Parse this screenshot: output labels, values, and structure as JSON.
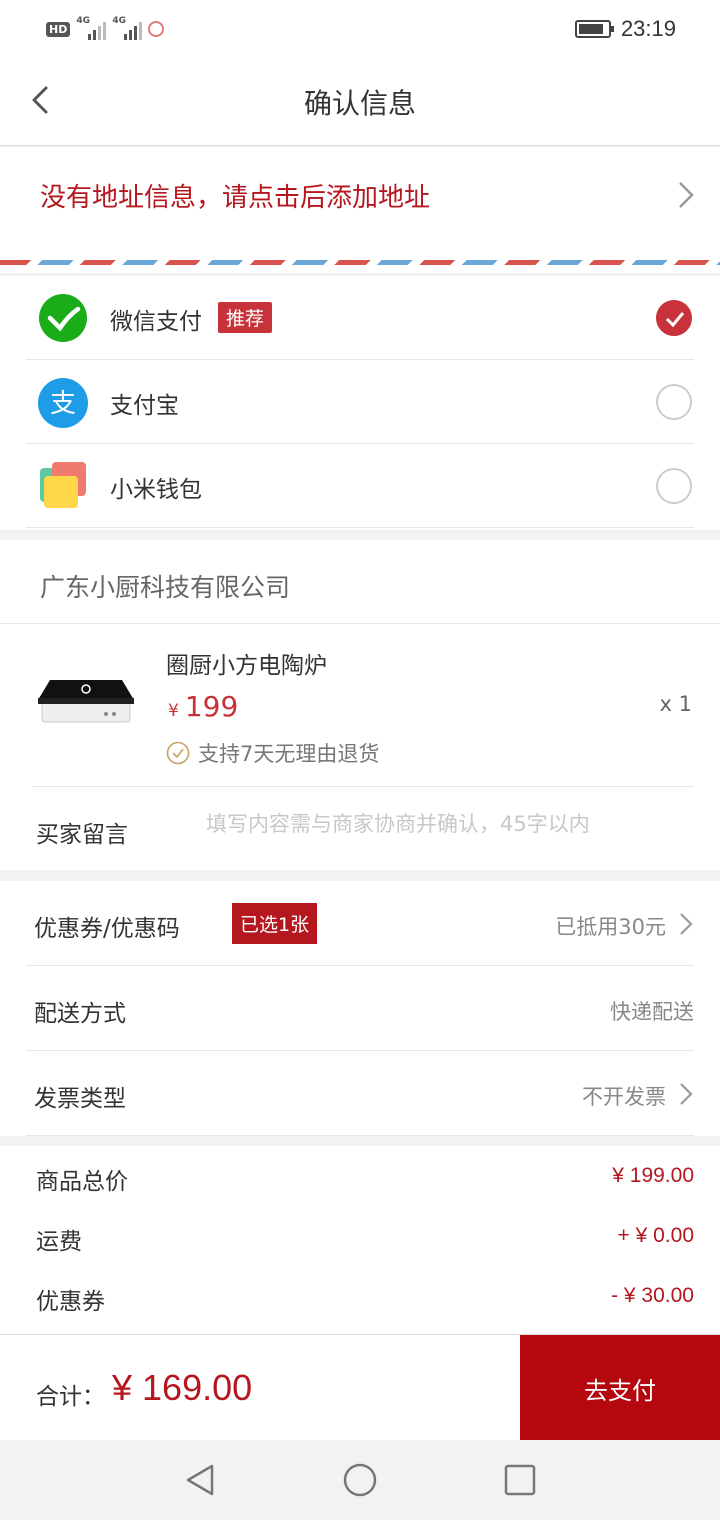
{
  "status_bar": {
    "hd": "HD",
    "net1": "4G",
    "net2": "4G",
    "time": "23:19"
  },
  "nav": {
    "title": "确认信息"
  },
  "address": {
    "prompt": "没有地址信息，请点击后添加地址"
  },
  "payment_methods": [
    {
      "label": "微信支付",
      "tag": "推荐",
      "selected": true,
      "icon": "wechat-pay-icon"
    },
    {
      "label": "支付宝",
      "selected": false,
      "icon": "alipay-icon"
    },
    {
      "label": "小米钱包",
      "selected": false,
      "icon": "mi-wallet-icon"
    }
  ],
  "shop": {
    "name": "广东小厨科技有限公司",
    "product": {
      "name": "圈厨小方电陶炉",
      "currency": "¥",
      "price": "199",
      "qty": "x 1",
      "return_policy": "支持7天无理由退货"
    },
    "message": {
      "label": "买家留言",
      "placeholder": "填写内容需与商家协商并确认，45字以内"
    }
  },
  "options": {
    "coupon": {
      "label": "优惠券/优惠码",
      "badge": "已选1张",
      "value": "已抵用30元"
    },
    "delivery": {
      "label": "配送方式",
      "value": "快递配送"
    },
    "invoice": {
      "label": "发票类型",
      "value": "不开发票"
    }
  },
  "summary": {
    "subtotal": {
      "label": "商品总价",
      "value": "¥ 199.00"
    },
    "shipping": {
      "label": "运费",
      "value": "+ ¥ 0.00"
    },
    "coupon": {
      "label": "优惠券",
      "value": "- ¥ 30.00"
    }
  },
  "checkout": {
    "total_label": "合计：",
    "total_value": "¥ 169.00",
    "pay_button": "去支付"
  },
  "colors": {
    "accent": "#b5171f",
    "tag_red": "#c8323a",
    "wechat_green": "#1aad19",
    "alipay_blue": "#1e9ce8"
  }
}
